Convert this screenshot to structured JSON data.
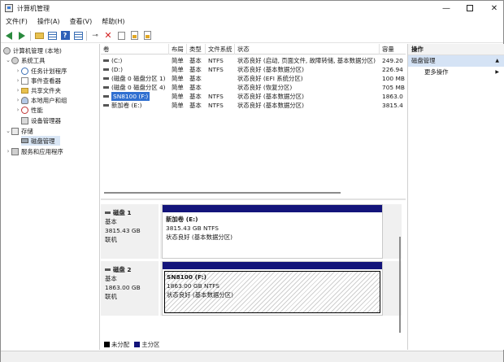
{
  "window": {
    "title": "计算机管理"
  },
  "menu": [
    "文件(F)",
    "操作(A)",
    "查看(V)",
    "帮助(H)"
  ],
  "toolbar": [
    "back-icon",
    "forward-icon",
    "folder-icon",
    "list-view-icon",
    "help-icon",
    "details-view-icon",
    "connect-icon",
    "delete-icon",
    "check-icon",
    "import-icon",
    "properties-icon"
  ],
  "tree": {
    "root": "计算机管理 (本地)",
    "system_tools": "系统工具",
    "task_scheduler": "任务计划程序",
    "event_viewer": "事件查看器",
    "shared_folders": "共享文件夹",
    "local_users": "本地用户和组",
    "performance": "性能",
    "device_manager": "设备管理器",
    "storage": "存储",
    "disk_management": "磁盘管理",
    "services": "服务和应用程序"
  },
  "volumes": {
    "columns": [
      "卷",
      "布局",
      "类型",
      "文件系统",
      "状态",
      "容量"
    ],
    "rows": [
      {
        "name": "(C:)",
        "layout": "简单",
        "type": "基本",
        "fs": "NTFS",
        "status": "状态良好 (启动, 页面文件, 故障转储, 基本数据分区)",
        "capacity": "249.20"
      },
      {
        "name": "(D:)",
        "layout": "简单",
        "type": "基本",
        "fs": "NTFS",
        "status": "状态良好 (基本数据分区)",
        "capacity": "226.94"
      },
      {
        "name": "(磁盘 0 磁盘分区 1)",
        "layout": "简单",
        "type": "基本",
        "fs": "",
        "status": "状态良好 (EFI 系统分区)",
        "capacity": "100 MB"
      },
      {
        "name": "(磁盘 0 磁盘分区 4)",
        "layout": "简单",
        "type": "基本",
        "fs": "",
        "status": "状态良好 (恢复分区)",
        "capacity": "705 MB"
      },
      {
        "name": "SN8100 (F:)",
        "layout": "简单",
        "type": "基本",
        "fs": "NTFS",
        "status": "状态良好 (基本数据分区)",
        "capacity": "1863.0"
      },
      {
        "name": "新加卷 (E:)",
        "layout": "简单",
        "type": "基本",
        "fs": "NTFS",
        "status": "状态良好 (基本数据分区)",
        "capacity": "3815.4"
      }
    ]
  },
  "disks": [
    {
      "name": "磁盘 1",
      "kind": "基本",
      "size": "3815.43 GB",
      "state": "联机",
      "partition": {
        "name": "新加卷  (E:)",
        "detail": "3815.43 GB NTFS",
        "status": "状态良好 (基本数据分区)"
      }
    },
    {
      "name": "磁盘 2",
      "kind": "基本",
      "size": "1863.00 GB",
      "state": "联机",
      "partition": {
        "name": "SN8100  (F:)",
        "detail": "1863.00 GB NTFS",
        "status": "状态良好 (基本数据分区)"
      }
    }
  ],
  "legend": {
    "unallocated": "未分配",
    "primary": "主分区"
  },
  "actions": {
    "header": "操作",
    "section": "磁盘管理",
    "more": "更多操作"
  },
  "colors": {
    "primary_partition": "#13147a",
    "selection": "#2f6fd0"
  }
}
